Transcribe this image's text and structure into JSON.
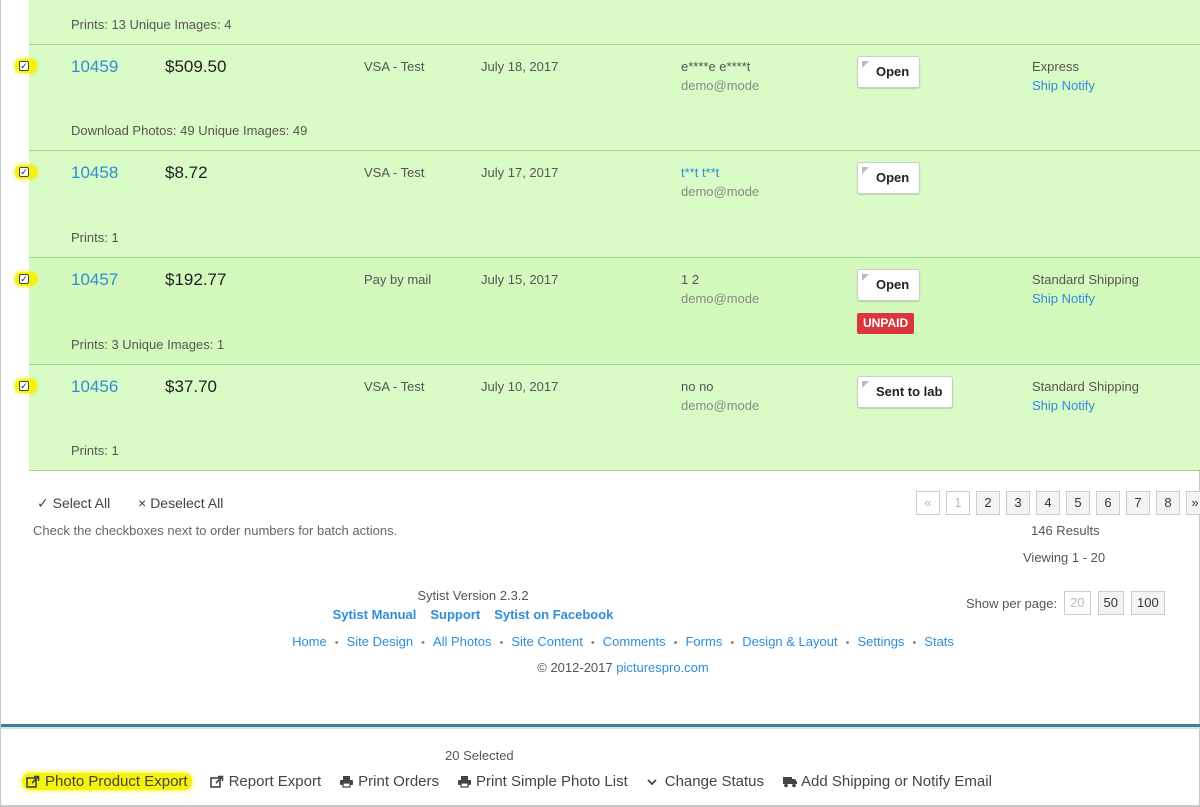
{
  "top_summary": "Prints: 13   Unique Images: 4",
  "orders": [
    {
      "number": "10459",
      "amount": "$509.50",
      "method": "VSA - Test",
      "date": "July 18, 2017",
      "name": "e****e e****t",
      "name_is_link": false,
      "email": "demo@mode",
      "status": "Open",
      "unpaid": "",
      "shipping": "Express",
      "notify": "Ship Notify",
      "summary": "Download Photos: 49   Unique Images: 49"
    },
    {
      "number": "10458",
      "amount": "$8.72",
      "method": "VSA - Test",
      "date": "July 17, 2017",
      "name": "t**t t**t",
      "name_is_link": true,
      "email": "demo@mode",
      "status": "Open",
      "unpaid": "",
      "shipping": "",
      "notify": "",
      "summary": "Prints: 1"
    },
    {
      "number": "10457",
      "amount": "$192.77",
      "method": "Pay by mail",
      "date": "July 15, 2017",
      "name": "1 2",
      "name_is_link": false,
      "email": "demo@mode",
      "status": "Open",
      "unpaid": "UNPAID",
      "shipping": "Standard Shipping",
      "notify": "Ship Notify",
      "summary": "Prints: 3   Unique Images: 1"
    },
    {
      "number": "10456",
      "amount": "$37.70",
      "method": "VSA - Test",
      "date": "July 10, 2017",
      "name": "no no",
      "name_is_link": false,
      "email": "demo@mode",
      "status": "Sent to lab",
      "unpaid": "",
      "shipping": "Standard Shipping",
      "notify": "Ship Notify",
      "summary": "Prints: 1"
    }
  ],
  "batch": {
    "select_all": "Select All",
    "deselect_all": "Deselect All",
    "hint": "Check the checkboxes next to order numbers for batch actions."
  },
  "pagination": {
    "prev": "«",
    "pages": [
      "1",
      "2",
      "3",
      "4",
      "5",
      "6",
      "7",
      "8"
    ],
    "current": "1",
    "next": "»",
    "results": "146 Results",
    "viewing": "Viewing 1 - 20"
  },
  "per_page": {
    "label": "Show per page:",
    "options": [
      "20",
      "50",
      "100"
    ],
    "current": "20"
  },
  "footer": {
    "version": "Sytist Version 2.3.2",
    "links_primary": [
      "Sytist Manual",
      "Support",
      "Sytist on Facebook"
    ],
    "links_nav": [
      "Home",
      "Site Design",
      "All Photos",
      "Site Content",
      "Comments",
      "Forms",
      "Design & Layout",
      "Settings",
      "Stats"
    ],
    "copyright_prefix": "© 2012-2017",
    "copyright_link": "picturespro.com"
  },
  "action_bar": {
    "selected": "20 Selected",
    "actions": [
      {
        "label": "Photo Product Export",
        "icon": "export-icon",
        "highlight": true
      },
      {
        "label": "Report Export",
        "icon": "export-icon",
        "highlight": false
      },
      {
        "label": "Print Orders",
        "icon": "printer-icon",
        "highlight": false
      },
      {
        "label": "Print Simple Photo List",
        "icon": "printer-icon",
        "highlight": false
      },
      {
        "label": "Change Status",
        "icon": "chevron-down-icon",
        "highlight": false
      },
      {
        "label": "Add Shipping or Notify Email",
        "icon": "truck-icon",
        "highlight": false
      }
    ]
  },
  "colors": {
    "row_bg": "#d9fbc5",
    "link": "#2f8dd8",
    "unpaid": "#d9363e",
    "highlight": "#f5f20b"
  }
}
